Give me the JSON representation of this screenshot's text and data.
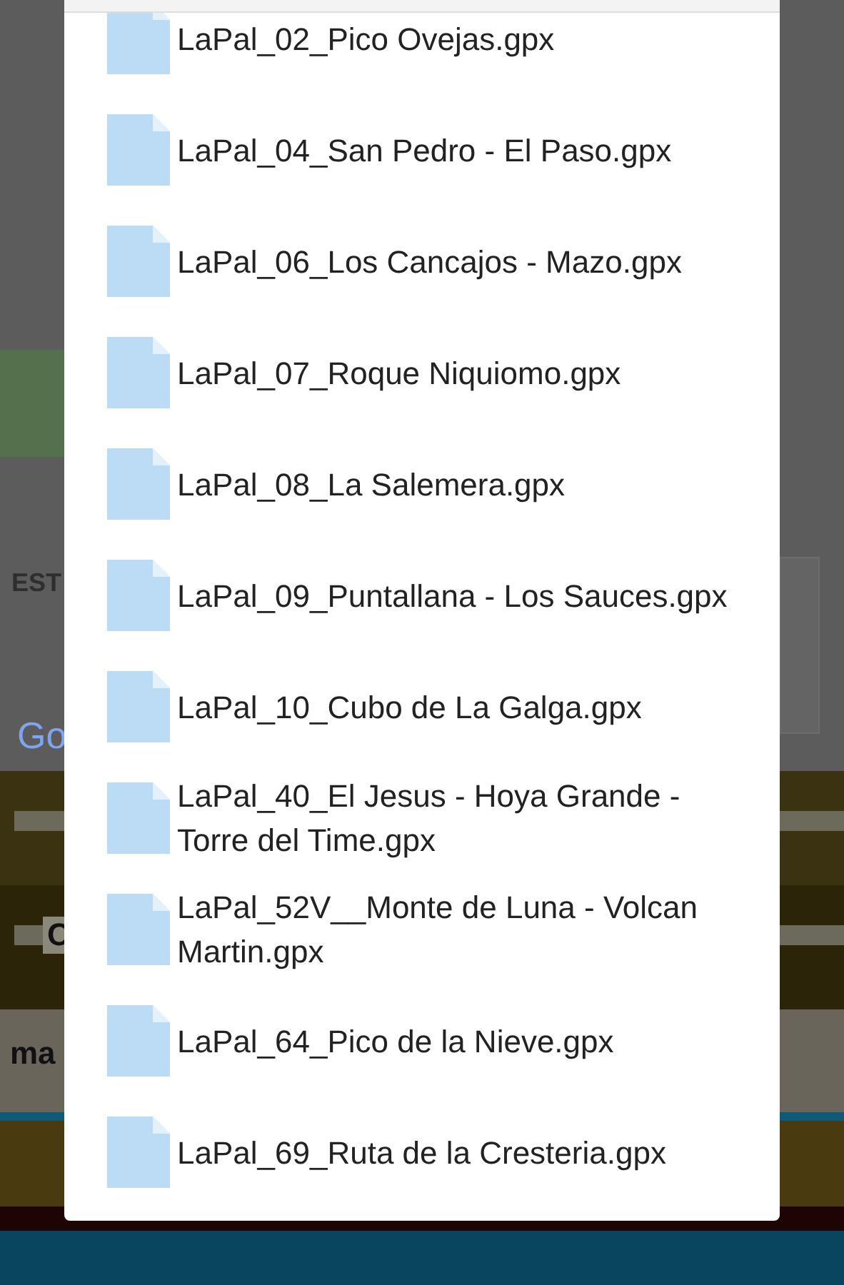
{
  "background": {
    "map_label": "EST",
    "map_attribution": "Go",
    "fragments": [
      {
        "kind": "card",
        "text": "C"
      },
      {
        "kind": "bar",
        "text": "ma"
      }
    ]
  },
  "dialog": {
    "files": [
      {
        "name": "LaPal_02_Pico Ovejas.gpx"
      },
      {
        "name": "LaPal_04_San Pedro - El Paso.gpx"
      },
      {
        "name": "LaPal_06_Los Cancajos - Mazo.gpx"
      },
      {
        "name": "LaPal_07_Roque Niquiomo.gpx"
      },
      {
        "name": "LaPal_08_La Salemera.gpx"
      },
      {
        "name": "LaPal_09_Puntallana - Los Sauces.gpx"
      },
      {
        "name": "LaPal_10_Cubo de La Galga.gpx"
      },
      {
        "name": "LaPal_40_El Jesus - Hoya Grande - Torre del Time.gpx"
      },
      {
        "name": "LaPal_52V__Monte de Luna - Volcan Martin.gpx"
      },
      {
        "name": "LaPal_64_Pico de la Nieve.gpx"
      },
      {
        "name": "LaPal_69_Ruta de la Cresteria.gpx"
      }
    ]
  }
}
